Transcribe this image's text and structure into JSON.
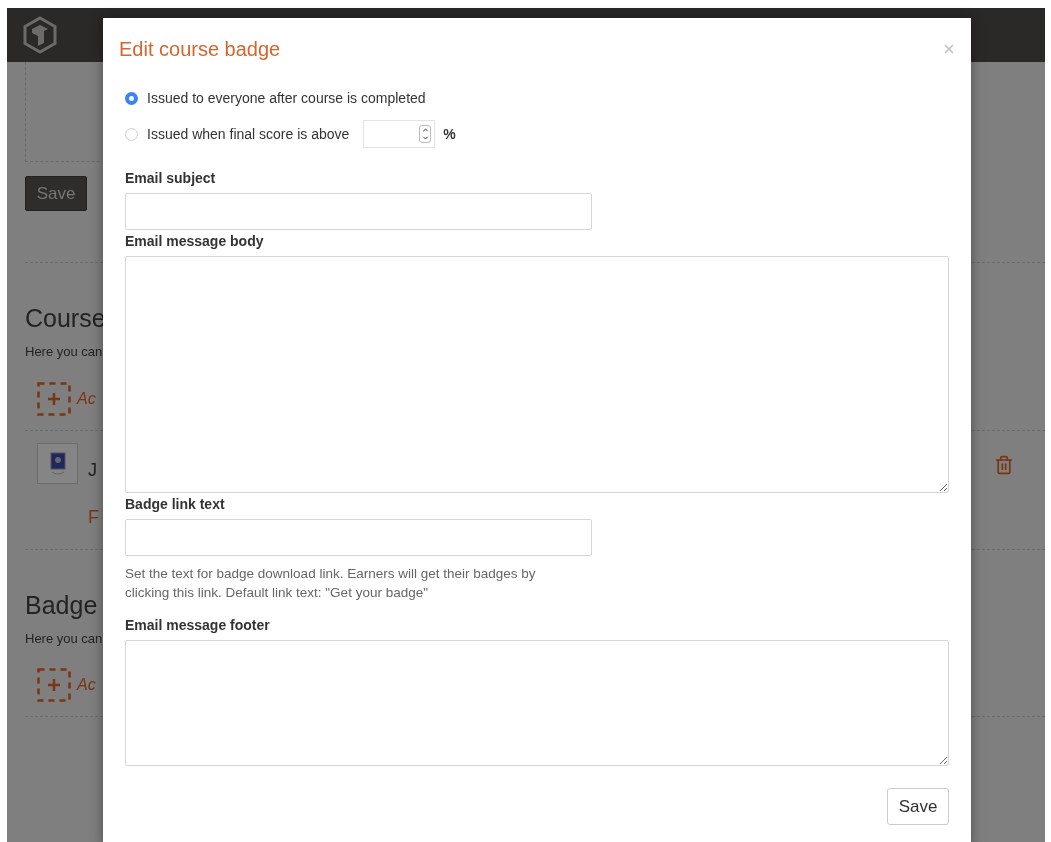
{
  "page": {
    "save_button": "Save",
    "sections": [
      {
        "heading": "Course",
        "description": "Here you can",
        "add_link": "Ac",
        "badges": [
          {
            "title": "J",
            "subtitle": "F"
          }
        ]
      },
      {
        "heading": "Badge",
        "description": "Here you can",
        "add_link": "Ac"
      }
    ]
  },
  "modal": {
    "title": "Edit course badge",
    "options": [
      {
        "label": "Issued to everyone after course is completed",
        "selected": true
      },
      {
        "label": "Issued when final score is above",
        "selected": false,
        "unit": "%"
      }
    ],
    "fields": [
      {
        "kind": "input",
        "label": "Email subject"
      },
      {
        "kind": "textarea",
        "label": "Email message body"
      },
      {
        "kind": "input",
        "label": "Badge link text",
        "help": "Set the text for badge download link. Earners will get their badges by clicking this link. Default link text: \"Get your badge\""
      },
      {
        "kind": "textarea",
        "label": "Email message footer"
      }
    ],
    "save_button": "Save"
  }
}
